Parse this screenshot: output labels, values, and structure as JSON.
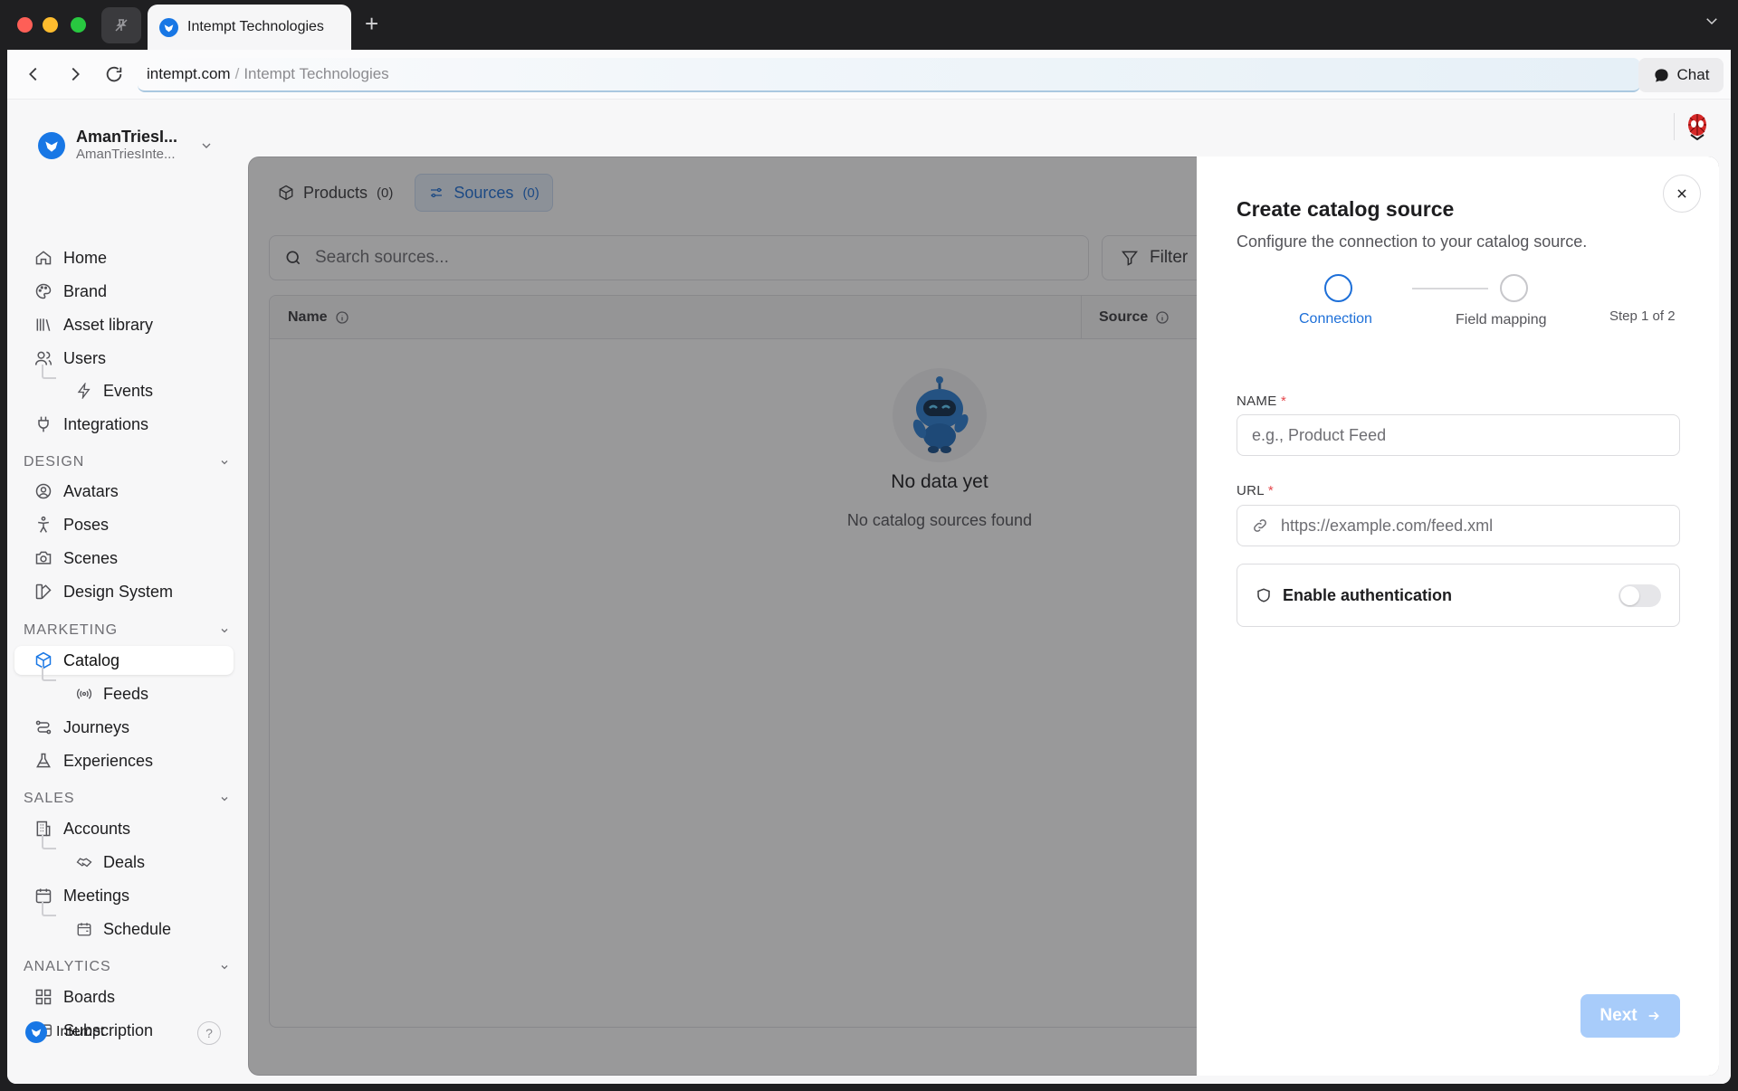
{
  "browser": {
    "tab_title": "Intempt Technologies",
    "url_host": "intempt.com",
    "url_separator": "/",
    "url_title": "Intempt Technologies",
    "chat_label": "Chat"
  },
  "org": {
    "name": "AmanTriesI...",
    "subtitle": "AmanTriesInte..."
  },
  "sidebar": {
    "top_items": [
      {
        "label": "Home",
        "icon": "home-icon"
      },
      {
        "label": "Brand",
        "icon": "palette-icon"
      },
      {
        "label": "Asset library",
        "icon": "library-icon"
      },
      {
        "label": "Users",
        "icon": "users-icon"
      },
      {
        "label": "Events",
        "icon": "bolt-icon"
      },
      {
        "label": "Integrations",
        "icon": "plug-icon"
      }
    ],
    "design": {
      "header": "DESIGN",
      "items": [
        {
          "label": "Avatars",
          "icon": "avatar-icon"
        },
        {
          "label": "Poses",
          "icon": "pose-icon"
        },
        {
          "label": "Scenes",
          "icon": "camera-icon"
        },
        {
          "label": "Design System",
          "icon": "design-system-icon"
        }
      ]
    },
    "marketing": {
      "header": "MARKETING",
      "items": [
        {
          "label": "Catalog",
          "icon": "box-icon",
          "active": true
        },
        {
          "label": "Feeds",
          "icon": "broadcast-icon"
        },
        {
          "label": "Journeys",
          "icon": "journey-icon"
        },
        {
          "label": "Experiences",
          "icon": "flask-icon"
        }
      ]
    },
    "sales": {
      "header": "SALES",
      "items": [
        {
          "label": "Accounts",
          "icon": "building-icon"
        },
        {
          "label": "Deals",
          "icon": "handshake-icon"
        },
        {
          "label": "Meetings",
          "icon": "calendar-icon"
        },
        {
          "label": "Schedule",
          "icon": "calendar-clock-icon"
        }
      ]
    },
    "analytics": {
      "header": "ANALYTICS",
      "items": [
        {
          "label": "Boards",
          "icon": "grid-icon"
        },
        {
          "label": "Subscription",
          "icon": "card-icon"
        }
      ]
    },
    "footer_label": "Intempt",
    "help_label": "?"
  },
  "main": {
    "tabs": [
      {
        "label": "Products",
        "count": "(0)",
        "active": false
      },
      {
        "label": "Sources",
        "count": "(0)",
        "active": true
      }
    ],
    "search_placeholder": "Search sources...",
    "filter_label": "Filter",
    "columns": [
      "Name",
      "Source"
    ],
    "empty_title": "No data yet",
    "empty_subtitle": "No catalog sources found"
  },
  "drawer": {
    "title": "Create catalog source",
    "subtitle": "Configure the connection to your catalog source.",
    "steps": [
      {
        "label": "Connection",
        "active": true
      },
      {
        "label": "Field mapping",
        "active": false
      }
    ],
    "step_count": "Step 1 of 2",
    "name_label": "NAME",
    "name_placeholder": "e.g., Product Feed",
    "url_label": "URL",
    "url_placeholder": "https://example.com/feed.xml",
    "required_mark": "*",
    "auth_label": "Enable authentication",
    "auth_enabled": false,
    "next_label": "Next"
  },
  "colors": {
    "accent": "#1877e5",
    "active_step": "#1d6fd8",
    "next_disabled": "#a8ccfa",
    "required": "#e5484d"
  }
}
